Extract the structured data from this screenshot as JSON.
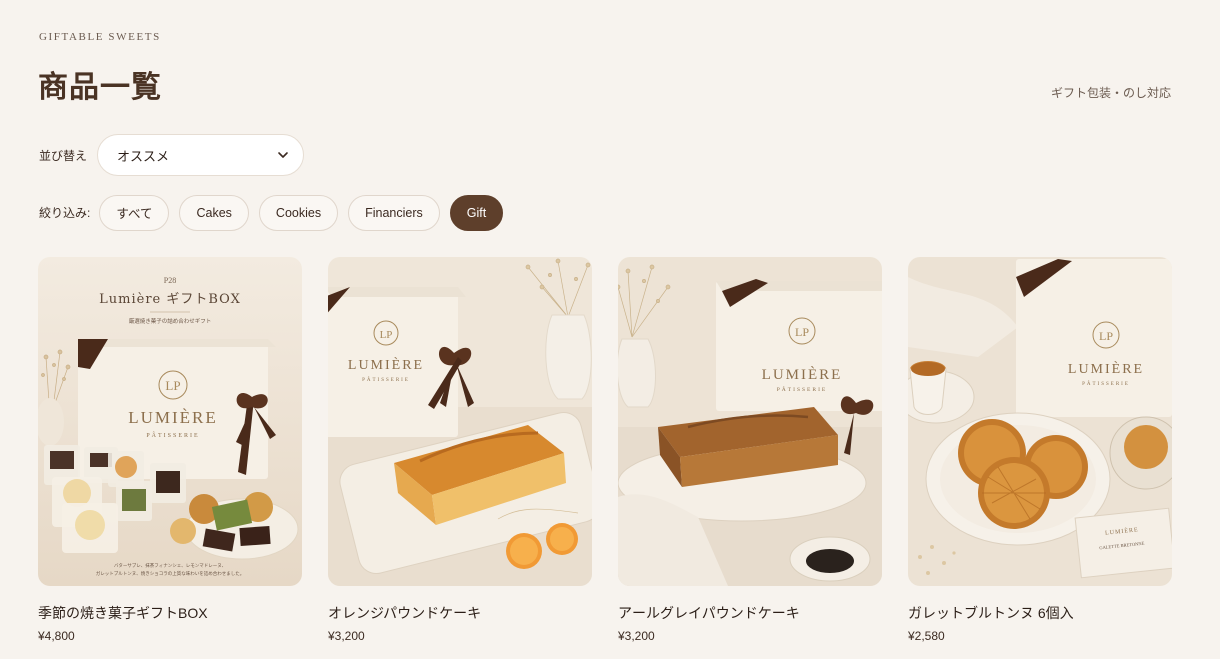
{
  "header": {
    "eyebrow": "GIFTABLE SWEETS",
    "title": "商品一覧",
    "gift_note": "ギフト包装・のし対応"
  },
  "sort": {
    "label": "並び替え",
    "selected": "オススメ"
  },
  "filter": {
    "label": "絞り込み:",
    "chips": [
      "すべて",
      "Cakes",
      "Cookies",
      "Financiers",
      "Gift"
    ],
    "active": "Gift"
  },
  "products": [
    {
      "name": "季節の焼き菓子ギフトBOX",
      "price": "¥4,800",
      "image": {
        "page": "P28",
        "headline": "Lumière ギフトBOX",
        "tagline": "厳選焼き菓子の詰め合わせギフト",
        "brand": "LUMIÈRE",
        "sub": "PÂTISSERIE",
        "monogram": "LP",
        "caption1": "バターサブレ、抹茶フィナンシェ、レモンマドレーヌ、",
        "caption2": "ガレットブルトンヌ、焼きショコラの上質な味わいを詰め合わせました。"
      }
    },
    {
      "name": "オレンジパウンドケーキ",
      "price": "¥3,200",
      "image": {
        "brand": "LUMIÈRE",
        "sub": "PÂTISSERIE",
        "monogram": "LP"
      }
    },
    {
      "name": "アールグレイパウンドケーキ",
      "price": "¥3,200",
      "image": {
        "brand": "LUMIÈRE",
        "sub": "PÂTISSERIE",
        "monogram": "LP"
      }
    },
    {
      "name": "ガレットブルトンヌ 6個入",
      "price": "¥2,580",
      "image": {
        "brand": "LUMIÈRE",
        "sub": "PÂTISSERIE",
        "monogram": "LP",
        "card_brand": "LUMIÈRE",
        "card_text": "GALETTE BRETONNE"
      }
    }
  ],
  "colors": {
    "background": "#f7f3ee",
    "accent": "#5e3f2b",
    "ribbon": "#4a2a1a",
    "gold": "#a88a5c"
  }
}
